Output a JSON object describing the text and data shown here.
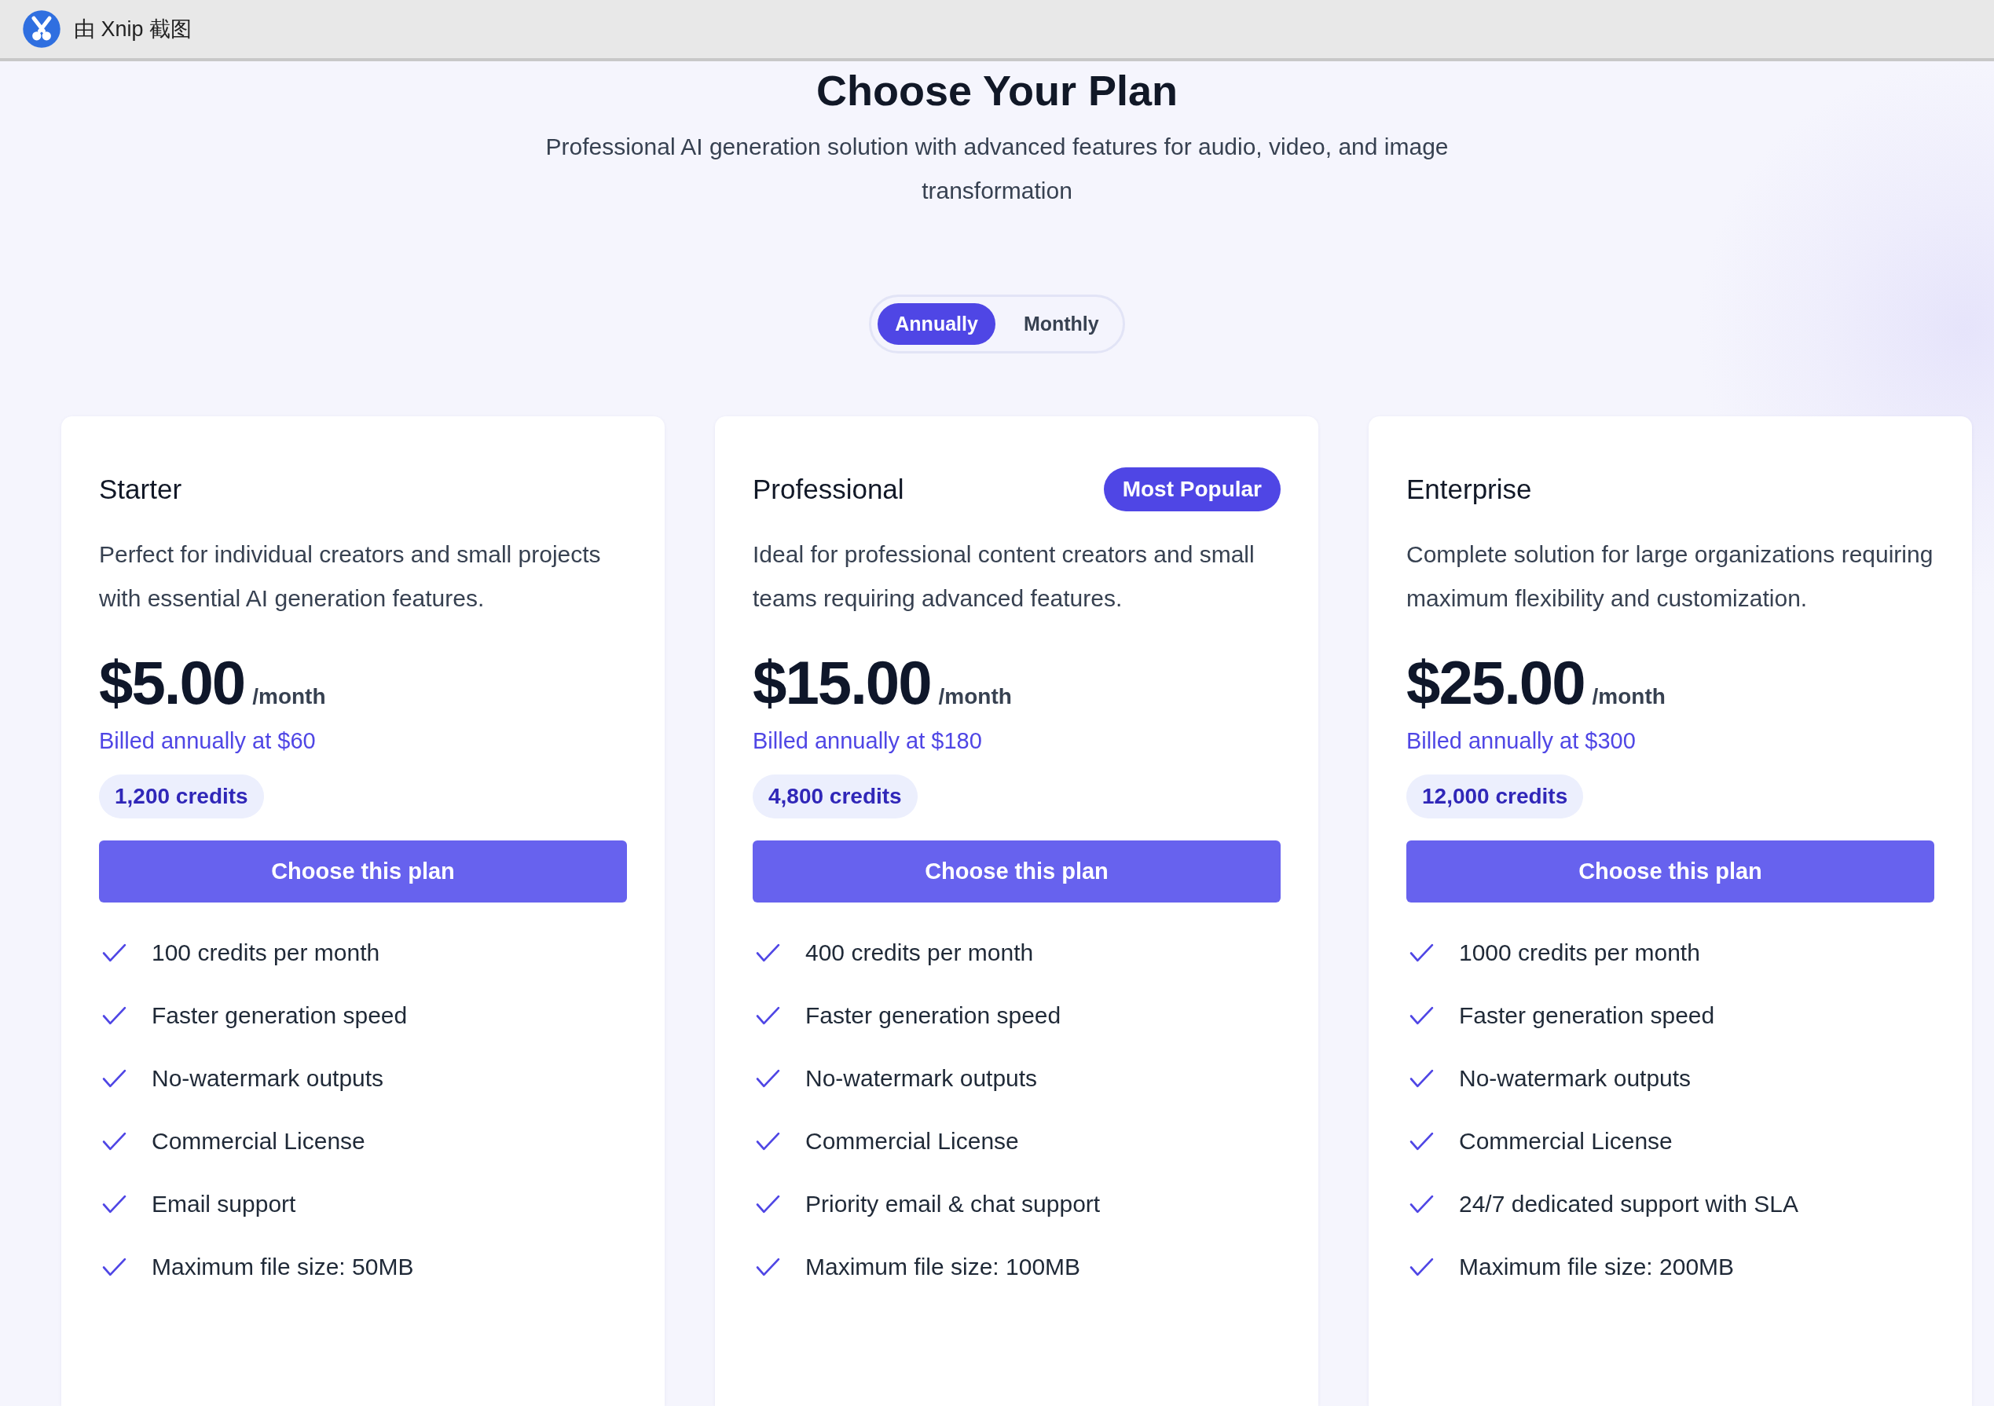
{
  "capture_bar": {
    "label": "由 Xnip 截图"
  },
  "heading": "Choose Your Plan",
  "subtitle": "Professional AI generation solution with advanced features for audio, video, and image transformation",
  "billing_toggle": [
    {
      "label": "Annually",
      "selected": true
    },
    {
      "label": "Monthly",
      "selected": false
    }
  ],
  "plans": [
    {
      "name": "Starter",
      "description": "Perfect for individual creators and small projects with essential AI generation features.",
      "price": "$5.00",
      "period": "/month",
      "billing": "Billed annually at $60",
      "credits": "1,200 credits",
      "button": "Choose this plan",
      "features": [
        "100 credits per month",
        "Faster generation speed",
        "No-watermark outputs",
        "Commercial License",
        "Email support",
        "Maximum file size: 50MB"
      ]
    },
    {
      "name": "Professional",
      "badge": "Most Popular",
      "description": "Ideal for professional content creators and small teams requiring advanced features.",
      "price": "$15.00",
      "period": "/month",
      "billing": "Billed annually at $180",
      "credits": "4,800 credits",
      "button": "Choose this plan",
      "features": [
        "400 credits per month",
        "Faster generation speed",
        "No-watermark outputs",
        "Commercial License",
        "Priority email & chat support",
        "Maximum file size: 100MB"
      ]
    },
    {
      "name": "Enterprise",
      "description": "Complete solution for large organizations requiring maximum flexibility and customization.",
      "price": "$25.00",
      "period": "/month",
      "billing": "Billed annually at $300",
      "credits": "12,000 credits",
      "button": "Choose this plan",
      "features": [
        "1000 credits per month",
        "Faster generation speed",
        "No-watermark outputs",
        "Commercial License",
        "24/7 dedicated support with SLA",
        "Maximum file size: 200MB"
      ]
    }
  ]
}
